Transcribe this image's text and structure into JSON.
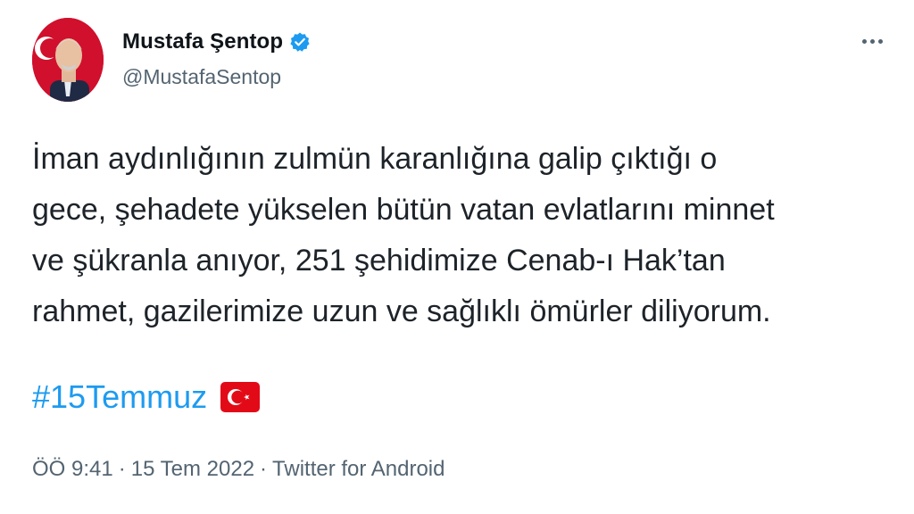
{
  "author": {
    "display_name": "Mustafa Şentop",
    "handle": "@MustafaSentop",
    "verified_icon": "verified-badge-icon",
    "verified_color": "#1d9bf0"
  },
  "menu": {
    "more_icon": "more-options-icon"
  },
  "tweet": {
    "lines": [
      "İman aydınlığının zulmün karanlığına galip çıktığı o",
      "gece, şehadete yükselen bütün vatan evlatlarını minnet",
      "ve şükranla anıyor, 251 şehidimize Cenab-ı Hak’tan",
      "rahmet, gazilerimize uzun ve sağlıklı ömürler diliyorum."
    ],
    "hashtag": "#15Temmuz",
    "hashtag_color": "#1d9bf0",
    "emoji_icon": "turkey-flag-icon"
  },
  "meta": {
    "time": "ÖÖ 9:41",
    "separator": "·",
    "date": "15 Tem 2022",
    "source": "Twitter for Android"
  }
}
